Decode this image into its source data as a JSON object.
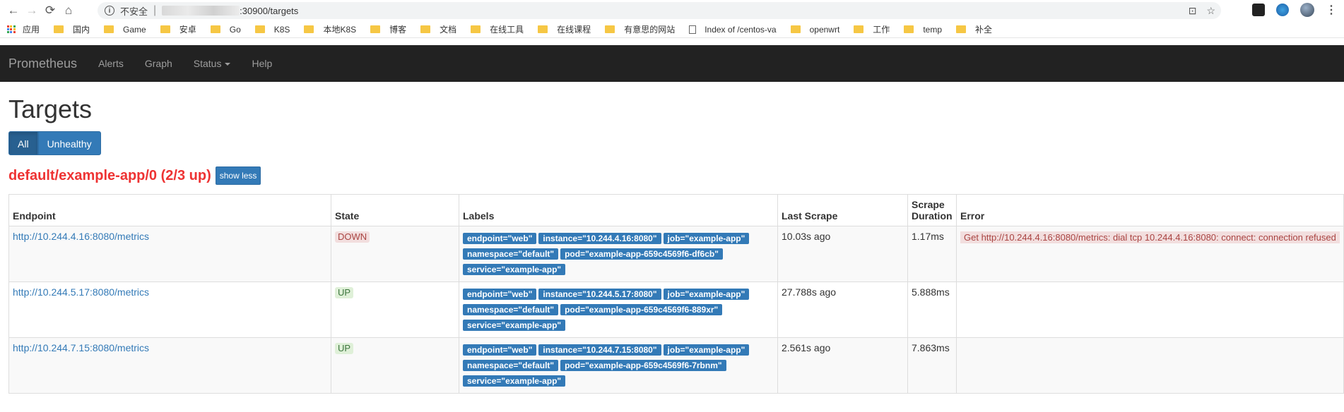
{
  "browser": {
    "insecure_label": "不安全",
    "url": ":30900/targets",
    "bookmarks": [
      {
        "label": "应用",
        "type": "apps"
      },
      {
        "label": "国内",
        "type": "folder"
      },
      {
        "label": "Game",
        "type": "folder"
      },
      {
        "label": "安卓",
        "type": "folder"
      },
      {
        "label": "Go",
        "type": "folder"
      },
      {
        "label": "K8S",
        "type": "folder"
      },
      {
        "label": "本地K8S",
        "type": "folder"
      },
      {
        "label": "博客",
        "type": "folder"
      },
      {
        "label": "文档",
        "type": "folder"
      },
      {
        "label": "在线工具",
        "type": "folder"
      },
      {
        "label": "在线课程",
        "type": "folder"
      },
      {
        "label": "有意思的网站",
        "type": "folder"
      },
      {
        "label": "Index of /centos-va",
        "type": "page"
      },
      {
        "label": "openwrt",
        "type": "folder"
      },
      {
        "label": "工作",
        "type": "folder"
      },
      {
        "label": "temp",
        "type": "folder"
      },
      {
        "label": "补全",
        "type": "folder"
      }
    ]
  },
  "navbar": {
    "brand": "Prometheus",
    "links": [
      "Alerts",
      "Graph",
      "Status",
      "Help"
    ]
  },
  "page": {
    "title": "Targets",
    "filter_all": "All",
    "filter_unhealthy": "Unhealthy",
    "job_title": "default/example-app/0 (2/3 up)",
    "show_less": "show less"
  },
  "table": {
    "headers": {
      "endpoint": "Endpoint",
      "state": "State",
      "labels": "Labels",
      "last_scrape": "Last Scrape",
      "scrape_duration": "Scrape Duration",
      "error": "Error"
    },
    "rows": [
      {
        "endpoint": "http://10.244.4.16:8080/metrics",
        "state": "DOWN",
        "labels": [
          "endpoint=\"web\"",
          "instance=\"10.244.4.16:8080\"",
          "job=\"example-app\"",
          "namespace=\"default\"",
          "pod=\"example-app-659c4569f6-df6cb\"",
          "service=\"example-app\""
        ],
        "last_scrape": "10.03s ago",
        "scrape_duration": "1.17ms",
        "error": "Get http://10.244.4.16:8080/metrics: dial tcp 10.244.4.16:8080: connect: connection refused"
      },
      {
        "endpoint": "http://10.244.5.17:8080/metrics",
        "state": "UP",
        "labels": [
          "endpoint=\"web\"",
          "instance=\"10.244.5.17:8080\"",
          "job=\"example-app\"",
          "namespace=\"default\"",
          "pod=\"example-app-659c4569f6-889xr\"",
          "service=\"example-app\""
        ],
        "last_scrape": "27.788s ago",
        "scrape_duration": "5.888ms",
        "error": ""
      },
      {
        "endpoint": "http://10.244.7.15:8080/metrics",
        "state": "UP",
        "labels": [
          "endpoint=\"web\"",
          "instance=\"10.244.7.15:8080\"",
          "job=\"example-app\"",
          "namespace=\"default\"",
          "pod=\"example-app-659c4569f6-7rbnm\"",
          "service=\"example-app\""
        ],
        "last_scrape": "2.561s ago",
        "scrape_duration": "7.863ms",
        "error": ""
      }
    ]
  }
}
